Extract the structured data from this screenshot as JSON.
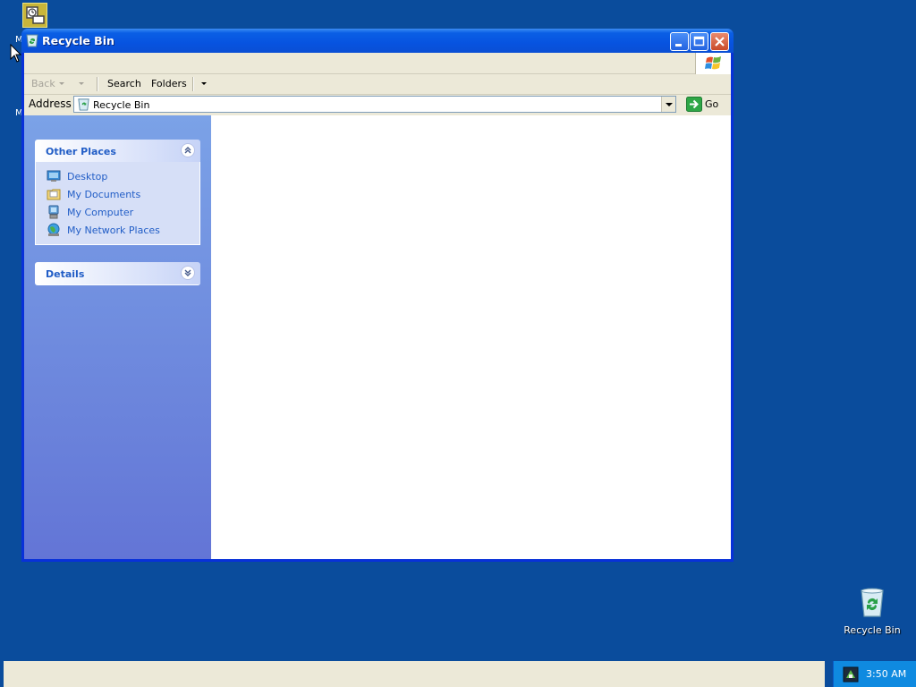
{
  "desktop": {
    "fragments": [
      "M",
      "M"
    ],
    "recycle_bin_label": "Recycle Bin"
  },
  "window": {
    "title": "Recycle Bin",
    "controls": {
      "minimize": "minimize",
      "maximize": "maximize",
      "close": "close"
    }
  },
  "toolbar": {
    "back_label": "Back",
    "search_label": "Search",
    "folders_label": "Folders"
  },
  "address": {
    "label": "Address",
    "value": "Recycle Bin",
    "go_label": "Go"
  },
  "taskpane": {
    "other_places": {
      "title": "Other Places",
      "links": [
        {
          "label": "Desktop",
          "icon": "desktop-icon"
        },
        {
          "label": "My Documents",
          "icon": "my-documents-icon"
        },
        {
          "label": "My Computer",
          "icon": "my-computer-icon"
        },
        {
          "label": "My Network Places",
          "icon": "network-places-icon"
        }
      ]
    },
    "details": {
      "title": "Details"
    }
  },
  "taskbar": {
    "clock": "3:50 AM"
  },
  "colors": {
    "desktop": "#0a4c9c",
    "title_bar": "#0753e0",
    "task_link": "#215dc6",
    "taskbar_tray": "#0f8ae0"
  }
}
